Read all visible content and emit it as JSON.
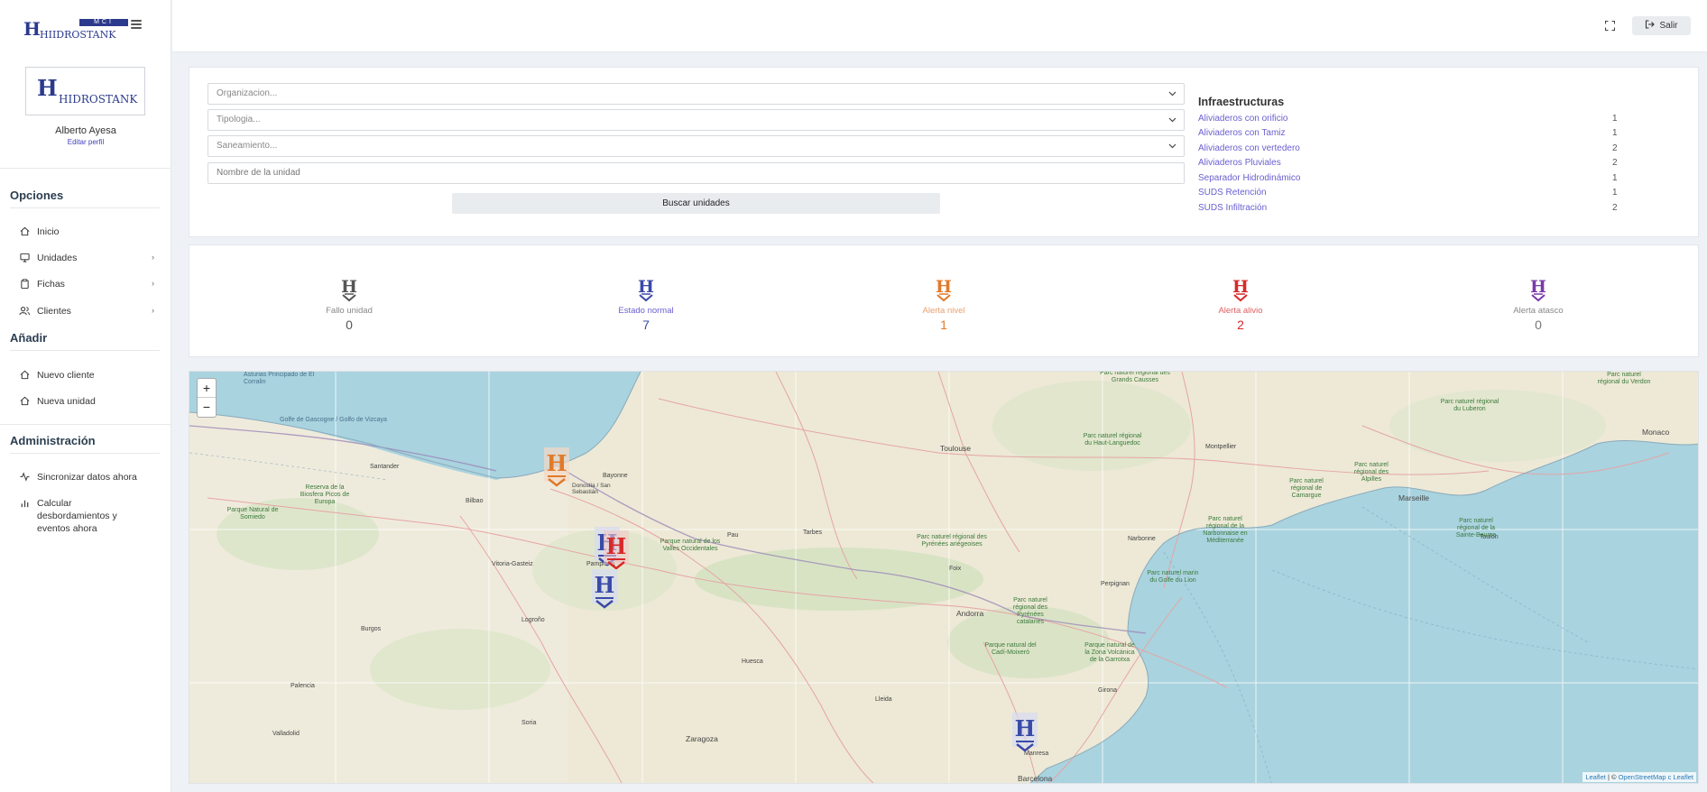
{
  "brand": {
    "name": "HIIDROSTANK",
    "logo_bar": "MCI",
    "profile_logo": "HIDROSTANK"
  },
  "user": {
    "name": "Alberto Ayesa",
    "edit_link": "Editar perfil"
  },
  "sidebar": {
    "sections": [
      {
        "title": "Opciones",
        "items": [
          {
            "label": "Inicio",
            "icon": "home-icon",
            "has_submenu": false
          },
          {
            "label": "Unidades",
            "icon": "monitor-icon",
            "has_submenu": true
          },
          {
            "label": "Fichas",
            "icon": "clipboard-icon",
            "has_submenu": true
          },
          {
            "label": "Clientes",
            "icon": "users-icon",
            "has_submenu": true
          }
        ]
      },
      {
        "title": "Añadir",
        "items": [
          {
            "label": "Nuevo cliente",
            "icon": "home-icon",
            "has_submenu": false
          },
          {
            "label": "Nueva unidad",
            "icon": "home-icon",
            "has_submenu": false
          }
        ]
      },
      {
        "title": "Administración",
        "items": [
          {
            "label": "Sincronizar datos ahora",
            "icon": "activity-icon",
            "has_submenu": false
          },
          {
            "label": "Calcular desbordamientos y eventos ahora",
            "icon": "bar-chart-icon",
            "has_submenu": false
          }
        ]
      }
    ]
  },
  "header": {
    "logout_label": "Salir"
  },
  "search": {
    "organizacion_placeholder": "Organizacion...",
    "tipologia_placeholder": "Tipologia...",
    "saneamiento_placeholder": "Saneamiento...",
    "unit_name_placeholder": "Nombre de la unidad",
    "button_label": "Buscar unidades"
  },
  "infra": {
    "title": "Infraestructuras",
    "rows": [
      {
        "label": "Aliviaderos con orificio",
        "count": "1"
      },
      {
        "label": "Aliviaderos con Tamiz",
        "count": "1"
      },
      {
        "label": "Aliviaderos con vertedero",
        "count": "2"
      },
      {
        "label": "Aliviaderos Pluviales",
        "count": "2"
      },
      {
        "label": "Separador Hidrodinámico",
        "count": "1"
      },
      {
        "label": "SUDS Retención",
        "count": "1"
      },
      {
        "label": "SUDS Infiltración",
        "count": "2"
      }
    ]
  },
  "status": [
    {
      "label": "Fallo unidad",
      "count": "0",
      "color": "#555555"
    },
    {
      "label": "Estado normal",
      "count": "7",
      "color": "#3a4aa8"
    },
    {
      "label": "Alerta nivel",
      "count": "1",
      "color": "#e07a2a"
    },
    {
      "label": "Alerta alivio",
      "count": "2",
      "color": "#d62a2a"
    },
    {
      "label": "Alerta atasco",
      "count": "0",
      "color": "#7a3aa8"
    }
  ],
  "map": {
    "zoom_in": "+",
    "zoom_out": "−",
    "attribution": {
      "leaflet": "Leaflet",
      "sep": " | © ",
      "osm": "OpenStreetMap c",
      "leaflet2": "Leaflet"
    },
    "labels": {
      "toulouse": "Toulouse",
      "marseille": "Marseille",
      "montpellier": "Montpellier",
      "monaco": "Monaco",
      "zaragoza": "Zaragoza",
      "barcelona": "Barcelona",
      "andorra": "Andorra",
      "bilbao": "Bilbao",
      "santander": "Santander",
      "huesca": "Huesca",
      "lleida": "Lleida",
      "girona": "Girona",
      "valladolid": "Valladolid",
      "burgos": "Burgos",
      "logrono": "Logroño",
      "pamplona": "Pamplona",
      "donostia": "Donostia / San Sebastián",
      "vitoria": "Vitoria-Gasteiz",
      "narbonne": "Narbonne",
      "perpignan": "Perpignan",
      "toulon": "Toulon",
      "palencia": "Palencia",
      "soria": "Soria",
      "manresa": "Manresa",
      "tarbes": "Tarbes",
      "pau": "Pau",
      "bayonne": "Bayonne",
      "foix": "Foix",
      "park1": "Parc naturel régional des Pyrénées ariégeoises",
      "park2": "Parc naturel régional des Grands Causses",
      "park3": "Parc naturel régional du Haut-Languedoc",
      "park4": "Parc naturel marin du Golfe du Lion",
      "park5": "Parc naturel régional de la Narbonnaise en Méditerranée",
      "park6": "Parc naturel régional des Pyrénées catalanes",
      "park7": "Parc naturel régional de Camargue",
      "park8": "Parc naturel régional du Luberon",
      "park9": "Parc naturel régional du Verdon",
      "park10": "Parc naturel régional de la Sainte-Baume",
      "park11": "Parc naturel régional des Alpilles",
      "park12": "Parque natural de los Valles Occidentales",
      "park13": "Parque natural de la Zona Volcánica de la Garrotxa",
      "park14": "Parque natural del Cadí-Moixeró",
      "park15": "Parque Natural de Somiedo",
      "park16": "Reserva de la Biosfera Picos de Europa",
      "sea1": "Golfe de Gascogne / Golfo de Vizcaya",
      "sea2": "Asturias Principado de El Corralin"
    }
  }
}
